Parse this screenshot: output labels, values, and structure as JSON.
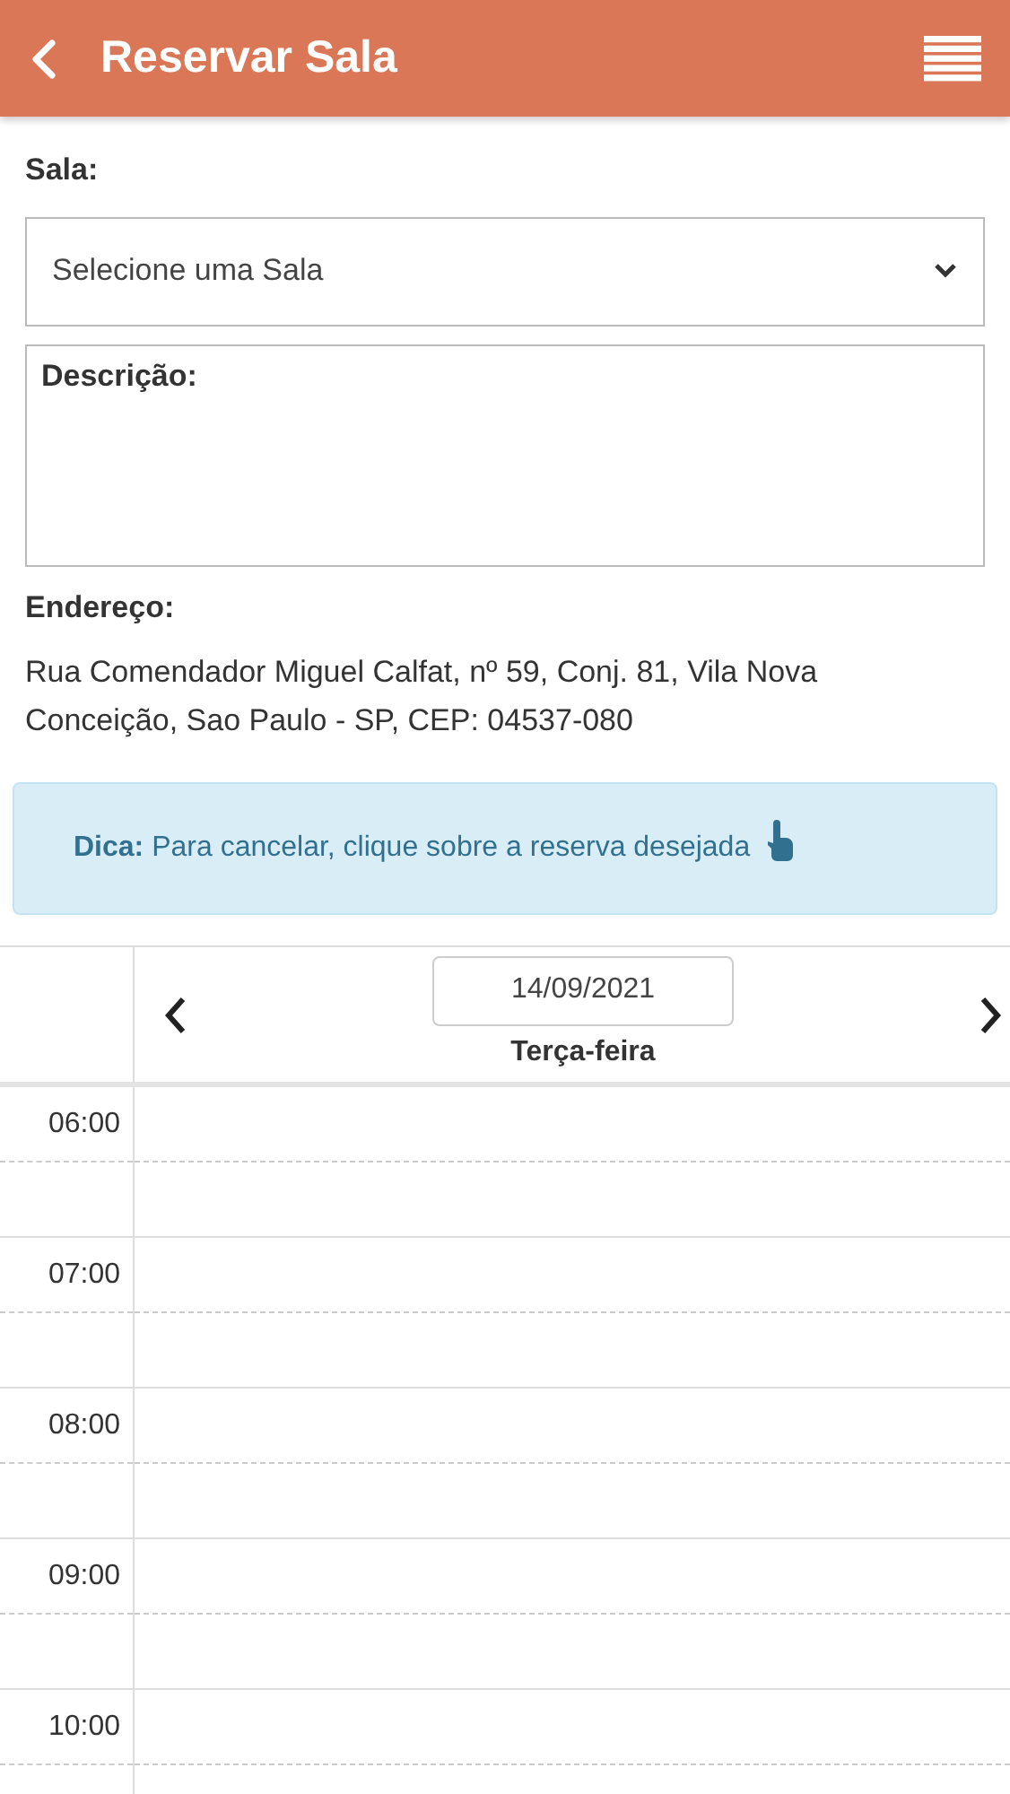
{
  "header": {
    "title": "Reservar Sala"
  },
  "room": {
    "label": "Sala:",
    "placeholder": "Selecione uma Sala"
  },
  "description": {
    "label": "Descrição:"
  },
  "address": {
    "label": "Endereço:",
    "text": "Rua Comendador Miguel Calfat, nº 59, Conj. 81, Vila Nova Conceição, Sao Paulo - SP, CEP: 04537-080"
  },
  "tip": {
    "text": "**Dica:** Para cancelar, clique sobre a reserva desejada"
  },
  "calendar": {
    "date": "14/09/2021",
    "weekday": "Terça-feira",
    "slots": [
      "06:00",
      "07:00",
      "08:00",
      "09:00",
      "10:00"
    ]
  }
}
